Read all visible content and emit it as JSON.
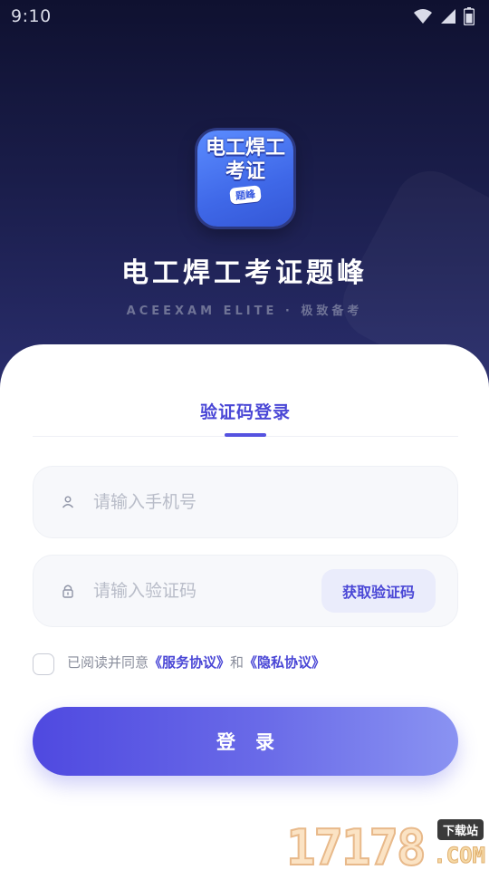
{
  "status_bar": {
    "time": "9:10",
    "icons": [
      "wifi-icon",
      "signal-icon",
      "battery-icon"
    ]
  },
  "app": {
    "icon_line1": "电工焊工",
    "icon_line2": "考证",
    "icon_badge": "题峰",
    "title": "电工焊工考证题峰",
    "subtitle": "ACEEXAM ELITE · 极致备考"
  },
  "login": {
    "tab_label": "验证码登录",
    "phone_placeholder": "请输入手机号",
    "phone_icon": "person-icon",
    "code_placeholder": "请输入验证码",
    "code_icon": "lock-icon",
    "get_code_label": "获取验证码",
    "agree_prefix": "已阅读并同意",
    "service_link": "《服务协议》",
    "agree_and": "和",
    "privacy_link": "《隐私协议》",
    "login_label": "登录"
  },
  "watermark": {
    "digits": "17178",
    "badge": "下载站",
    "dotcom": ".COM"
  },
  "colors": {
    "accent": "#4a47d6",
    "hero_dark": "#0f1130",
    "hero_light": "#2a2e6e",
    "button_start": "#4f49e0",
    "button_end": "#8a93f2"
  }
}
